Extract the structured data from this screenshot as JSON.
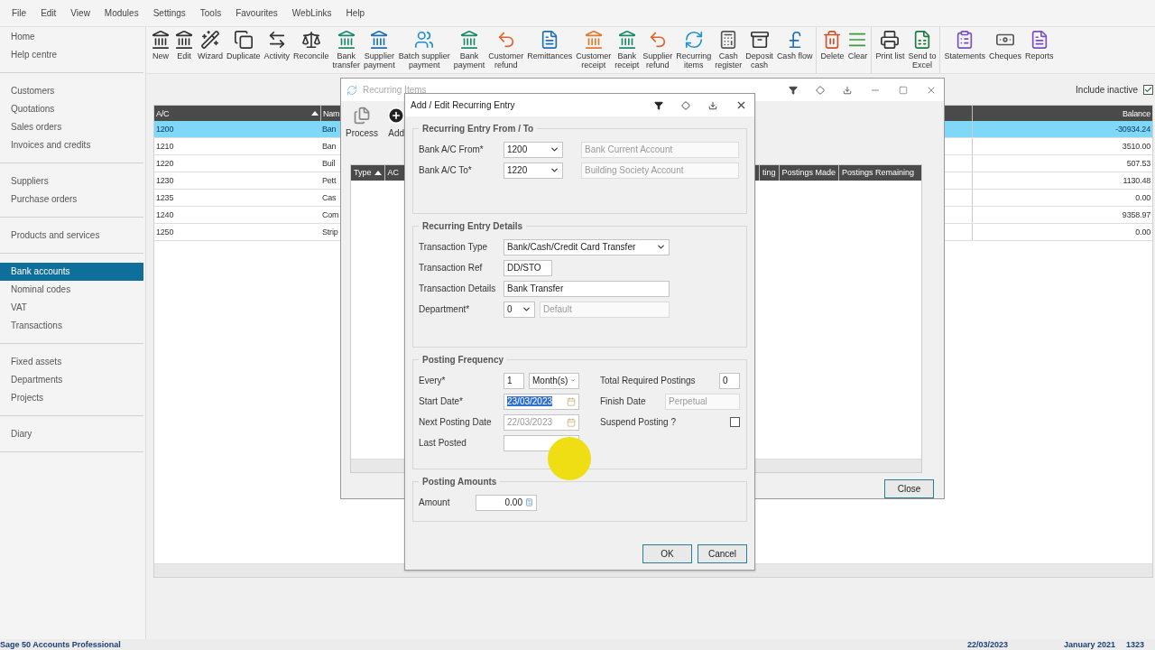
{
  "menu": [
    "File",
    "Edit",
    "View",
    "Modules",
    "Settings",
    "Tools",
    "Favourites",
    "WebLinks",
    "Help"
  ],
  "sidebar": {
    "groups": [
      {
        "items": [
          {
            "label": "Home",
            "selected": false
          },
          {
            "label": "Help centre",
            "selected": false
          }
        ]
      },
      {
        "items": [
          {
            "label": "Customers",
            "selected": false
          },
          {
            "label": "Quotations",
            "selected": false
          },
          {
            "label": "Sales orders",
            "selected": false
          },
          {
            "label": "Invoices and credits",
            "selected": false
          }
        ]
      },
      {
        "items": [
          {
            "label": "Suppliers",
            "selected": false
          },
          {
            "label": "Purchase orders",
            "selected": false
          }
        ]
      },
      {
        "items": [
          {
            "label": "Products and services",
            "selected": false
          }
        ]
      },
      {
        "items": [
          {
            "label": "Bank accounts",
            "selected": true
          },
          {
            "label": "Nominal codes",
            "selected": false
          },
          {
            "label": "VAT",
            "selected": false
          },
          {
            "label": "Transactions",
            "selected": false
          }
        ]
      },
      {
        "items": [
          {
            "label": "Fixed assets",
            "selected": false
          },
          {
            "label": "Departments",
            "selected": false
          },
          {
            "label": "Projects",
            "selected": false
          }
        ]
      },
      {
        "items": [
          {
            "label": "Diary",
            "selected": false
          }
        ]
      }
    ]
  },
  "toolbar": {
    "groups": [
      {
        "buttons": [
          "New",
          "Edit",
          "Wizard",
          "Duplicate",
          "Activity",
          "Reconcile",
          "Bank\ntransfer",
          "Supplier\npayment",
          "Batch supplier\npayment",
          "Bank\npayment",
          "Customer\nrefund",
          "Remittances",
          "Customer\nreceipt",
          "Bank\nreceipt",
          "Supplier\nrefund",
          "Recurring\nitems",
          "Cash\nregister",
          "Deposit\ncash",
          "Cash flow"
        ]
      },
      {
        "buttons": [
          "Delete",
          "Clear"
        ]
      },
      {
        "buttons": [
          "Print list",
          "Send to\nExcel"
        ]
      },
      {
        "buttons": [
          "Statements",
          "Cheques",
          "Reports"
        ]
      }
    ]
  },
  "main": {
    "include_inactive": {
      "label": "Include inactive",
      "checked": true
    },
    "table": {
      "columns": [
        {
          "label": "A/C",
          "sorted": true
        },
        {
          "label": "Nam",
          "sorted": false
        },
        {
          "label": "Balance",
          "sorted": false
        }
      ],
      "rows": [
        {
          "ac": "1200",
          "name": "Ban",
          "balance": "-30934.24",
          "selected": true
        },
        {
          "ac": "1210",
          "name": "Ban",
          "balance": "3510.00",
          "selected": false
        },
        {
          "ac": "1220",
          "name": "Buil",
          "balance": "507.53",
          "selected": false
        },
        {
          "ac": "1230",
          "name": "Pett",
          "balance": "1130.48",
          "selected": false
        },
        {
          "ac": "1235",
          "name": "Cas",
          "balance": "0.00",
          "selected": false
        },
        {
          "ac": "1240",
          "name": "Com",
          "balance": "9358.97",
          "selected": false
        },
        {
          "ac": "1250",
          "name": "Strip",
          "balance": "0.00",
          "selected": false
        }
      ]
    }
  },
  "recurring_items_window": {
    "title": "Recurring Items",
    "active": false,
    "tools": [
      "Process",
      "Add"
    ],
    "list": {
      "left_columns": [
        {
          "label": "Type",
          "sorted": true
        },
        {
          "label": "AC",
          "sorted": false
        }
      ],
      "right_columns": [
        {
          "label": "ting",
          "sorted": false
        },
        {
          "label": "Postings Made",
          "sorted": false
        },
        {
          "label": "Postings Remaining",
          "sorted": false
        }
      ]
    },
    "close_button": "Close"
  },
  "dialog": {
    "title": "Add / Edit Recurring Entry",
    "sections": [
      {
        "title": "Recurring Entry From / To",
        "columns": [
          [
            {
              "kind": "account",
              "label": "Bank A/C From*",
              "value": "1200",
              "description": "Bank Current Account"
            },
            {
              "kind": "account",
              "label": "Bank A/C To*",
              "value": "1220",
              "description": "Building Society Account"
            }
          ]
        ]
      },
      {
        "title": "Recurring Entry Details",
        "columns": [
          [
            {
              "kind": "dropdown",
              "label": "Transaction Type",
              "value": "Bank/Cash/Credit Card Transfer"
            },
            {
              "kind": "short-text",
              "label": "Transaction Ref",
              "value": "DD/STO"
            },
            {
              "kind": "text",
              "label": "Transaction Details",
              "value": "Bank Transfer"
            },
            {
              "kind": "department",
              "label": "Department*",
              "value": "0",
              "description": "Default"
            }
          ]
        ]
      },
      {
        "title": "Posting Frequency",
        "columns": [
          [
            {
              "kind": "interval",
              "label": "Every*",
              "value": "1",
              "unit": "Month(s)"
            },
            {
              "kind": "date",
              "label": "Start Date*",
              "value": "23/03/2023",
              "text_selected": true,
              "disabled": false
            },
            {
              "kind": "date",
              "label": "Next Posting Date",
              "value": "22/03/2023",
              "text_selected": false,
              "disabled": true
            },
            {
              "kind": "blank",
              "label": "Last Posted"
            }
          ],
          [
            {
              "kind": "number",
              "label": "Total Required Postings",
              "value": "0"
            },
            {
              "kind": "readonly",
              "label": "Finish Date",
              "value": "Perpetual"
            },
            {
              "kind": "checkbox",
              "label": "Suspend Posting ?",
              "checked": false
            }
          ]
        ]
      },
      {
        "title": "Posting Amounts",
        "columns": [
          [
            {
              "kind": "amount",
              "label": "Amount",
              "value": "0.00"
            }
          ]
        ]
      }
    ],
    "buttons": [
      "OK",
      "Cancel"
    ]
  },
  "status_bar": {
    "product": "Sage 50 Accounts Professional",
    "date": "22/03/2023",
    "period": "January 2021",
    "number": "1323"
  },
  "cursor_highlight": true
}
